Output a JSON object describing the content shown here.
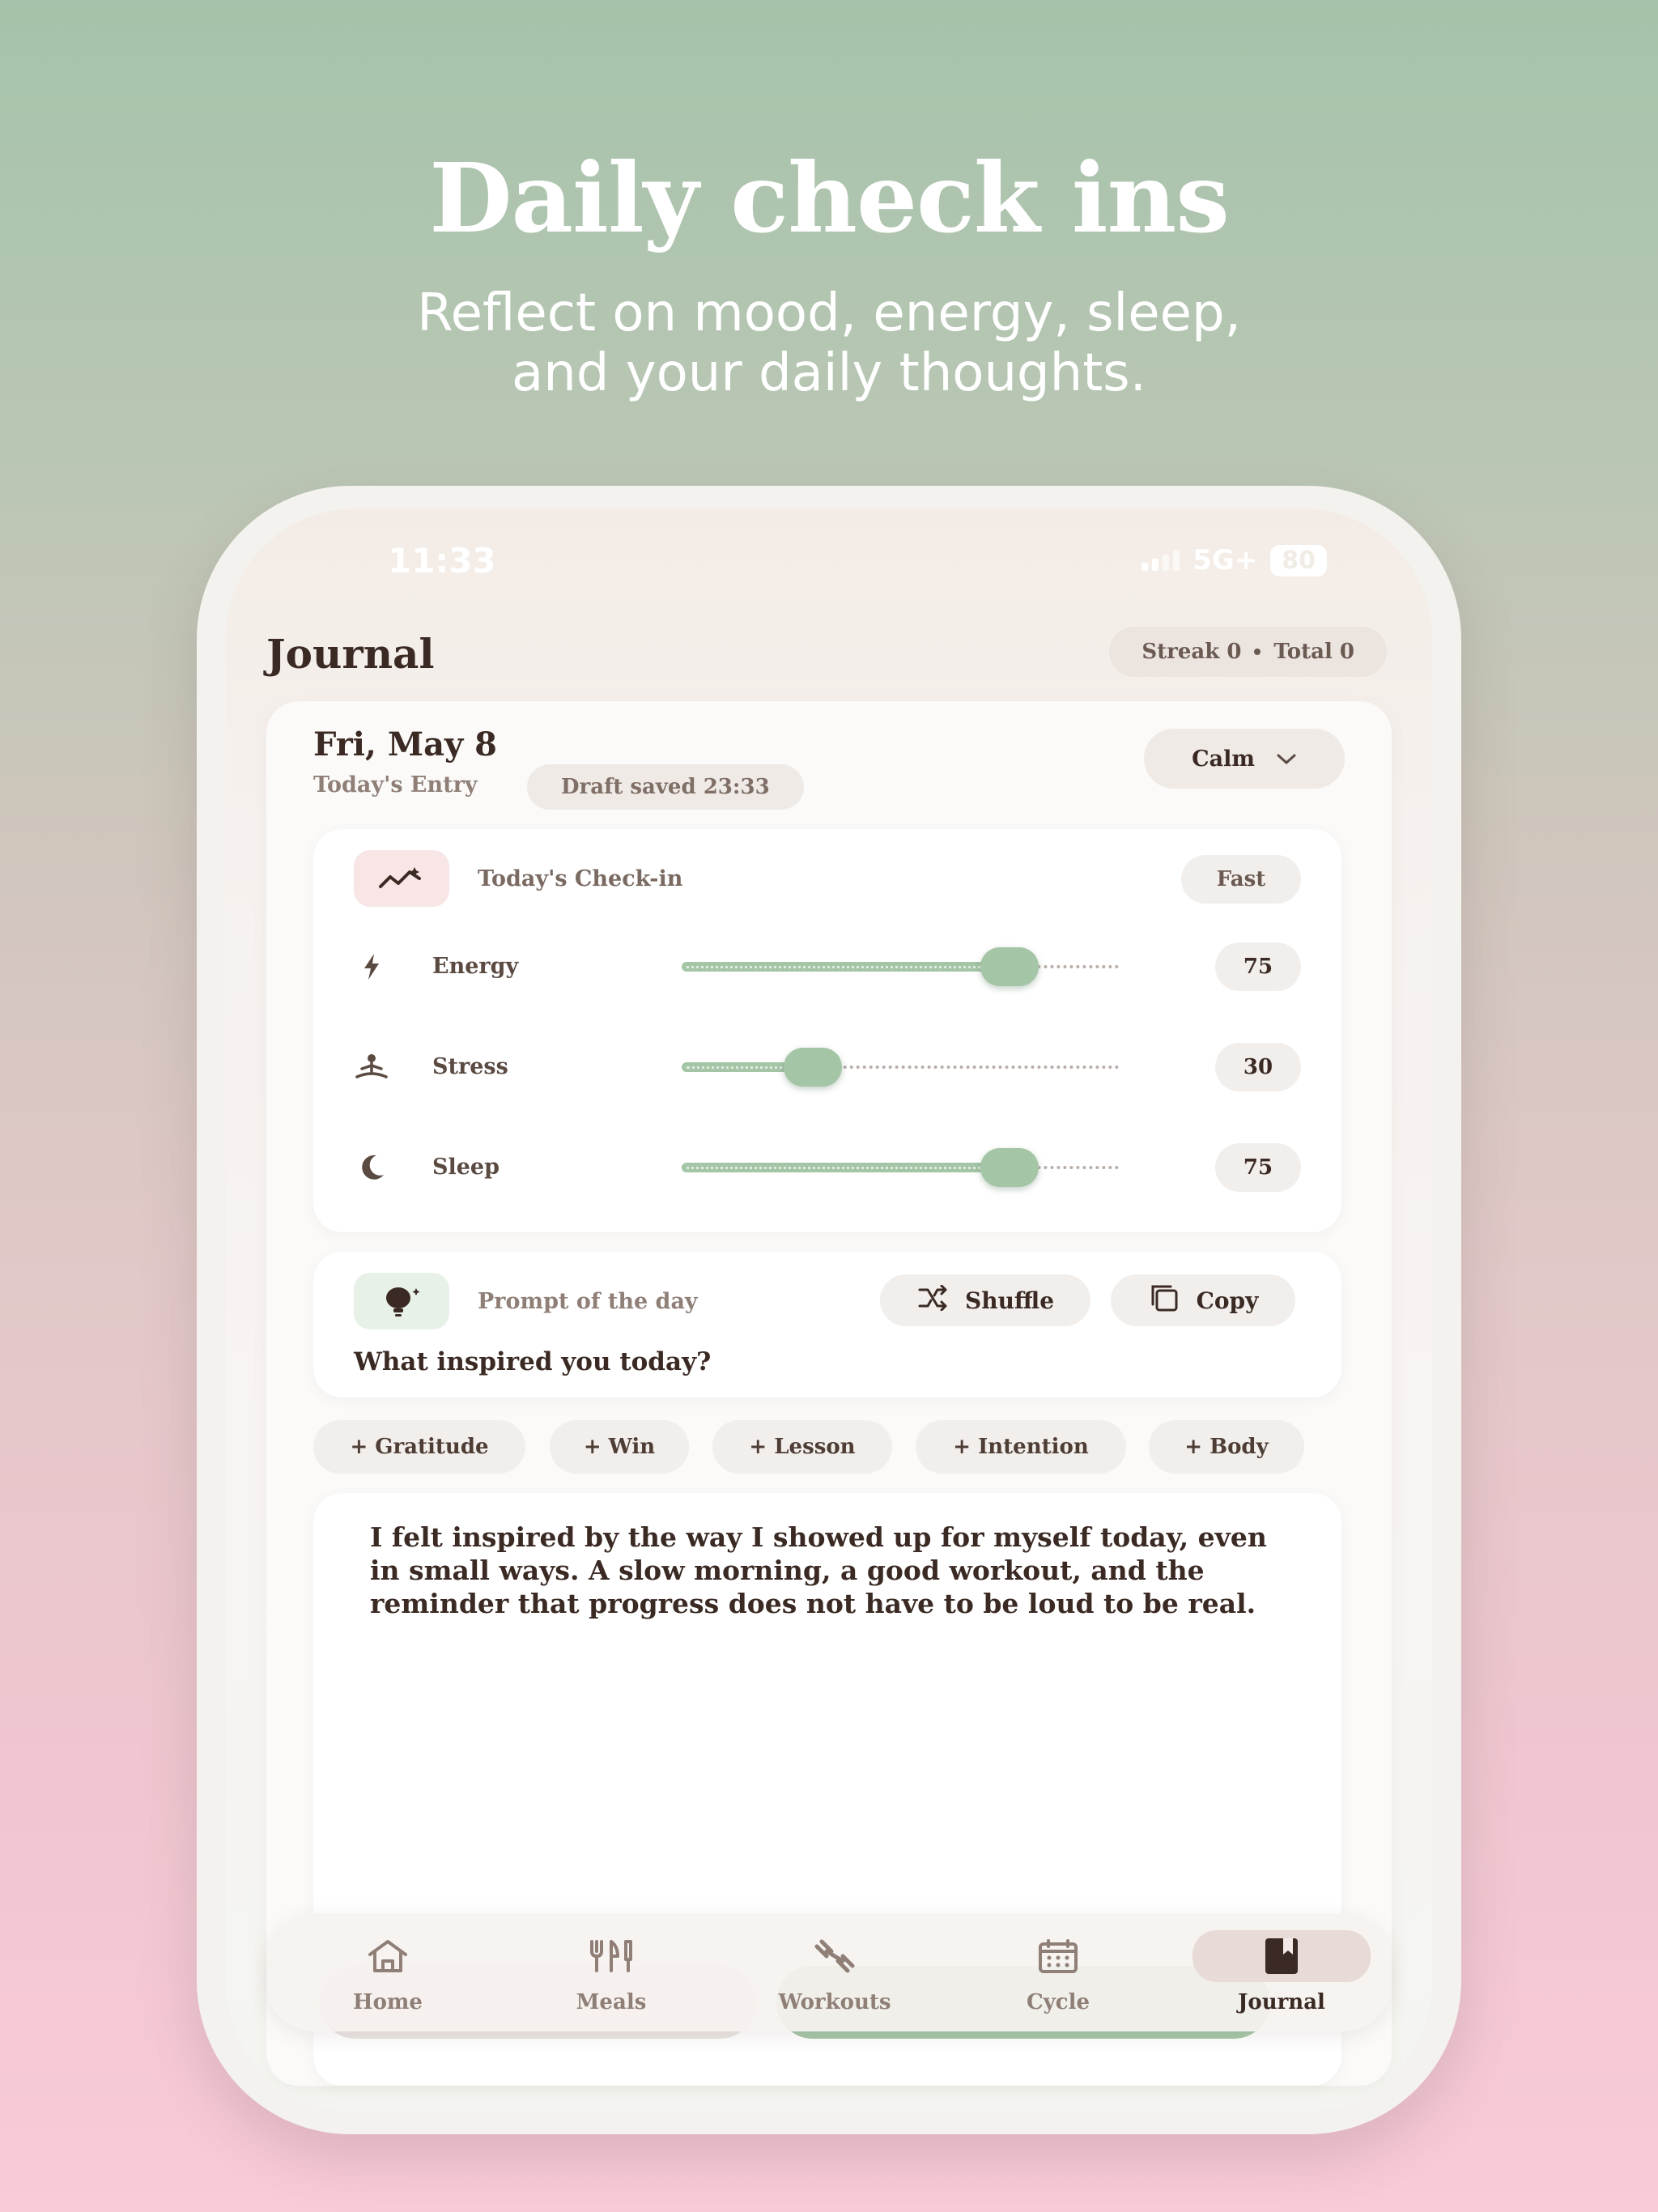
{
  "hero": {
    "title": "Daily check ins",
    "subtitle_line1": "Reflect on mood, energy, sleep,",
    "subtitle_line2": "and your daily thoughts."
  },
  "status_bar": {
    "time": "11:33",
    "network": "5G+",
    "battery": "80"
  },
  "header": {
    "title": "Journal",
    "streak_label": "Streak 0",
    "total_label": "Total 0"
  },
  "entry": {
    "date": "Fri, May 8",
    "label": "Today's Entry",
    "draft_status": "Draft saved 23:33",
    "mood": "Calm"
  },
  "checkin": {
    "title": "Today's Check-in",
    "mode": "Fast",
    "metrics": [
      {
        "label": "Energy",
        "value": "75",
        "fraction": 0.75,
        "icon": "lightning-icon"
      },
      {
        "label": "Stress",
        "value": "30",
        "fraction": 0.3,
        "icon": "meditation-icon"
      },
      {
        "label": "Sleep",
        "value": "75",
        "fraction": 0.75,
        "icon": "moon-icon"
      }
    ]
  },
  "prompt": {
    "label": "Prompt of the day",
    "shuffle_label": "Shuffle",
    "copy_label": "Copy",
    "question": "What inspired you today?"
  },
  "chips": [
    "+ Gratitude",
    "+ Win",
    "+ Lesson",
    "+ Intention",
    "+ Body"
  ],
  "editor": {
    "text": "I felt inspired by the way I showed up for myself today, even in small ways. A slow morning, a good workout, and the reminder that progress does not have to be loud to be real."
  },
  "tabs": [
    {
      "label": "Home",
      "icon": "home-icon",
      "active": false
    },
    {
      "label": "Meals",
      "icon": "utensils-icon",
      "active": false
    },
    {
      "label": "Workouts",
      "icon": "dumbbell-icon",
      "active": false
    },
    {
      "label": "Cycle",
      "icon": "calendar-icon",
      "active": false
    },
    {
      "label": "Journal",
      "icon": "book-icon",
      "active": true
    }
  ],
  "colors": {
    "accent_green": "#a4c5a6",
    "text_dark": "#3b2a24",
    "pill_bg": "#f2eeeb"
  }
}
